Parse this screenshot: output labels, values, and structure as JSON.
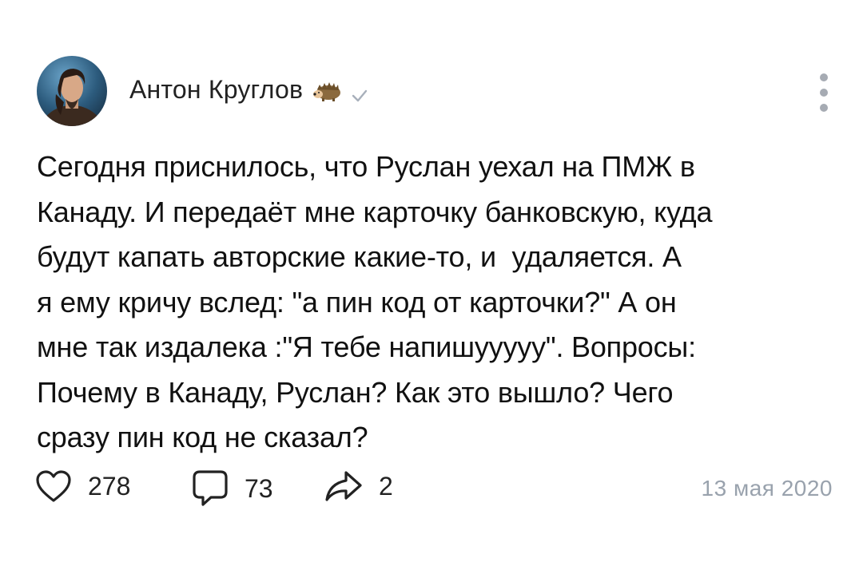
{
  "post": {
    "author": {
      "name": "Антон Круглов",
      "badge_icon": "hedgehog-icon",
      "verified_icon": "checkmark-icon"
    },
    "text": "Сегодня приснилось, что Руслан уехал на ПМЖ в\nКанаду. И передаёт мне карточку банковскую, куда\nбудут капать авторские какие-то, и  удаляется. А\nя ему кричу вслед: \"а пин код от карточки?\" А он\nмне так издалека :\"Я тебе напишууууу\". Вопросы:\nПочему в Канаду, Руслан? Как это вышло? Чего\nсразу пин код не сказал?",
    "actions": {
      "likes": "278",
      "comments": "73",
      "shares": "2"
    },
    "date": "13 мая 2020"
  },
  "colors": {
    "text": "#111111",
    "muted": "#99a2ad",
    "icon": "#222222"
  }
}
